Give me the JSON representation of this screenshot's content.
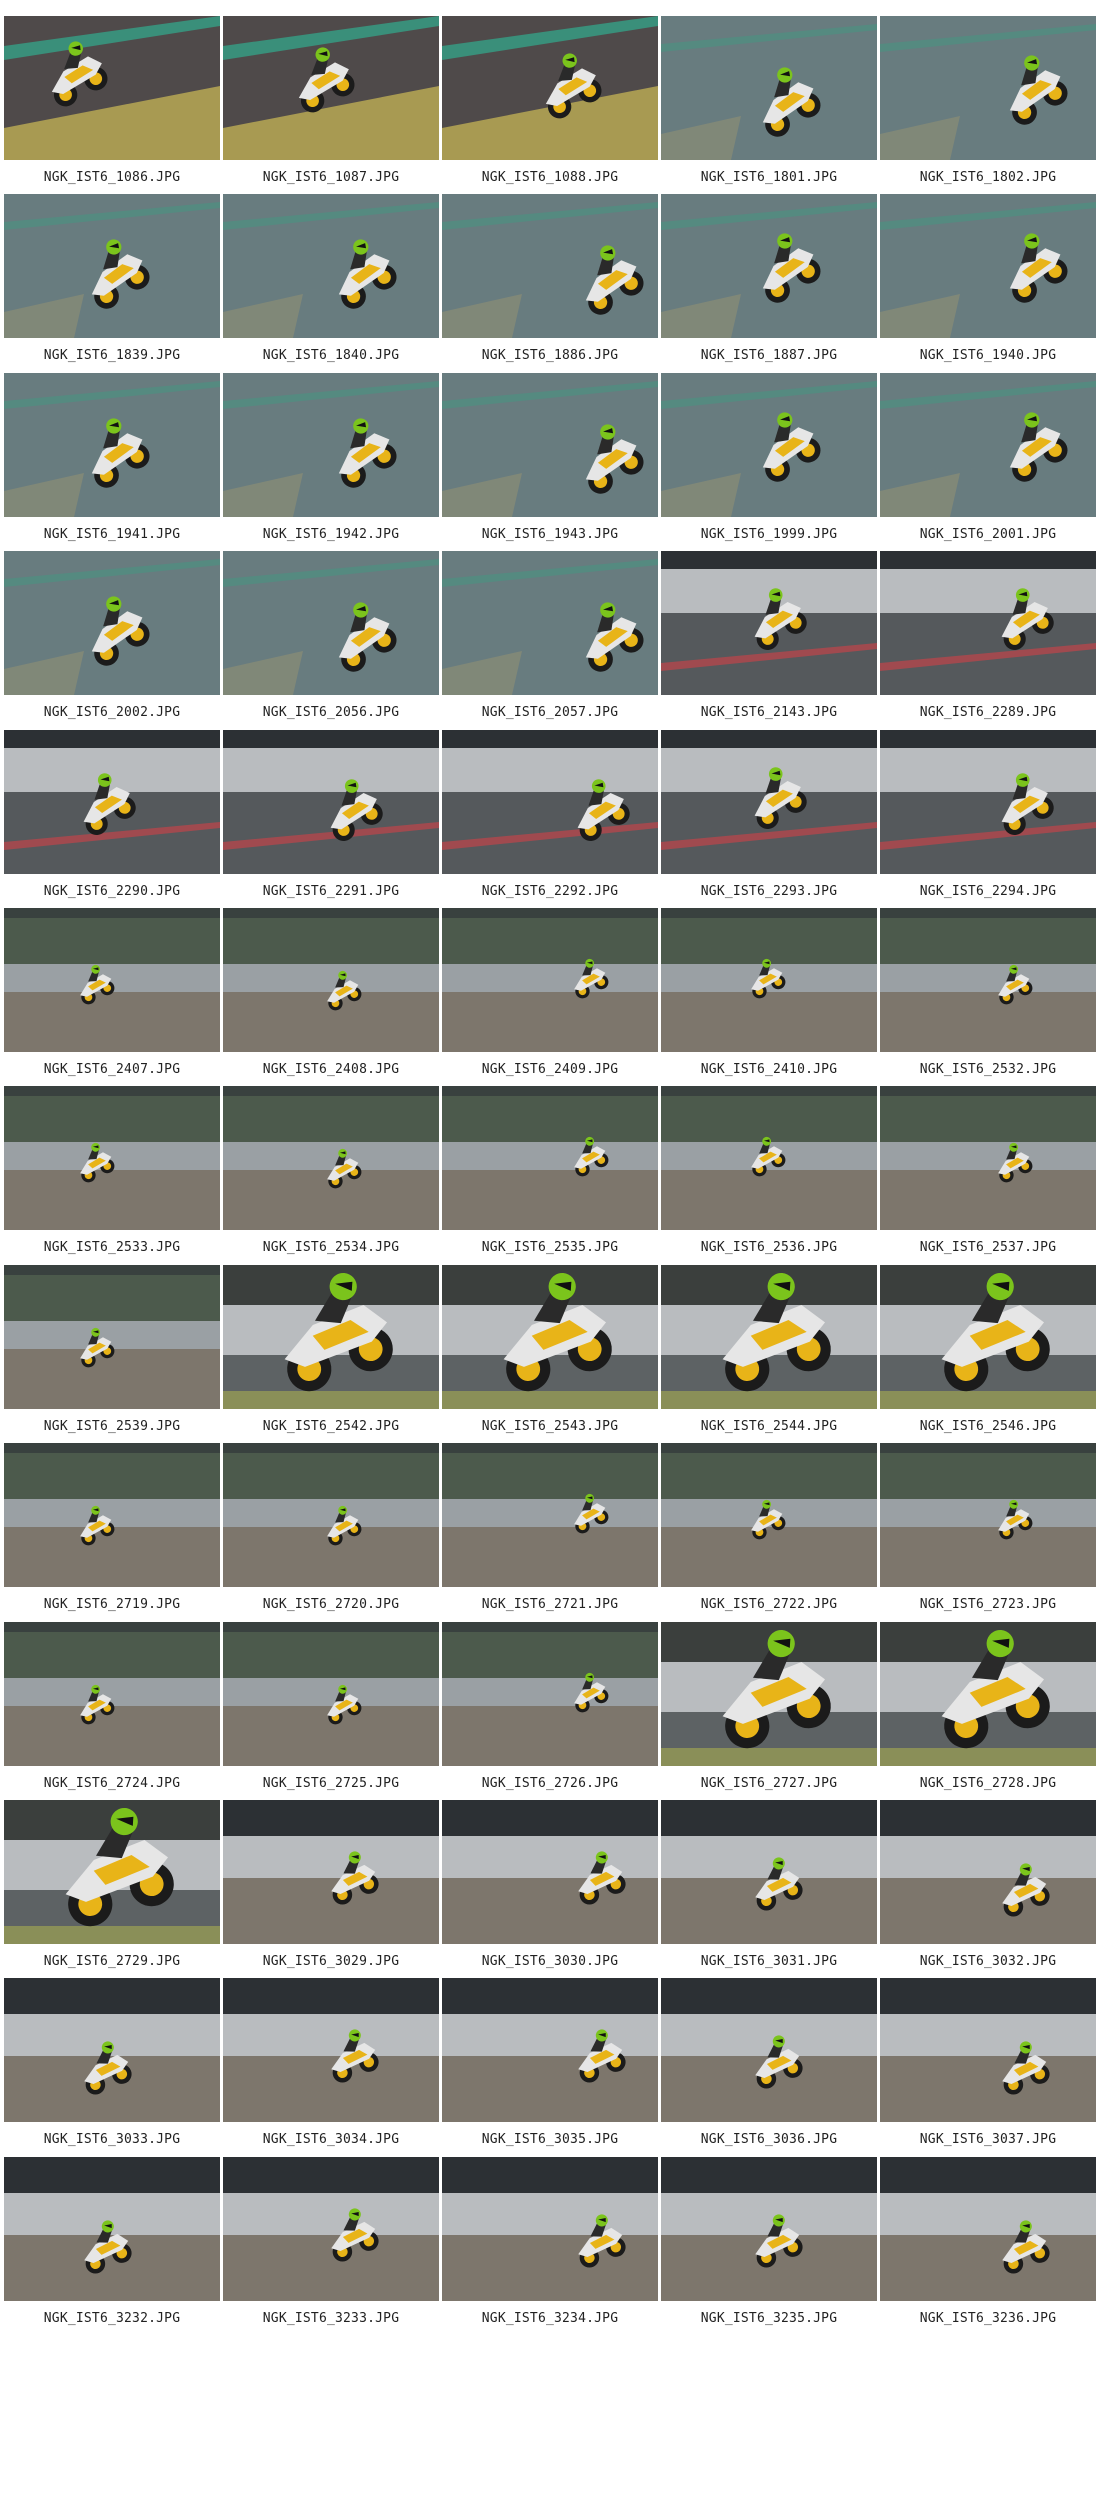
{
  "contact_sheet": {
    "items": [
      {
        "filename": "NGK_IST6_1086.JPG",
        "scene": "dry-grass"
      },
      {
        "filename": "NGK_IST6_1087.JPG",
        "scene": "dry-grass"
      },
      {
        "filename": "NGK_IST6_1088.JPG",
        "scene": "dry-grass"
      },
      {
        "filename": "NGK_IST6_1801.JPG",
        "scene": "wet-track"
      },
      {
        "filename": "NGK_IST6_1802.JPG",
        "scene": "wet-track"
      },
      {
        "filename": "NGK_IST6_1839.JPG",
        "scene": "wet-track"
      },
      {
        "filename": "NGK_IST6_1840.JPG",
        "scene": "wet-track"
      },
      {
        "filename": "NGK_IST6_1886.JPG",
        "scene": "wet-track"
      },
      {
        "filename": "NGK_IST6_1887.JPG",
        "scene": "wet-track"
      },
      {
        "filename": "NGK_IST6_1940.JPG",
        "scene": "wet-track"
      },
      {
        "filename": "NGK_IST6_1941.JPG",
        "scene": "wet-track"
      },
      {
        "filename": "NGK_IST6_1942.JPG",
        "scene": "wet-track"
      },
      {
        "filename": "NGK_IST6_1943.JPG",
        "scene": "wet-track"
      },
      {
        "filename": "NGK_IST6_1999.JPG",
        "scene": "wet-track"
      },
      {
        "filename": "NGK_IST6_2001.JPG",
        "scene": "wet-track"
      },
      {
        "filename": "NGK_IST6_2002.JPG",
        "scene": "wet-track"
      },
      {
        "filename": "NGK_IST6_2056.JPG",
        "scene": "wet-track"
      },
      {
        "filename": "NGK_IST6_2057.JPG",
        "scene": "wet-track"
      },
      {
        "filename": "NGK_IST6_2143.JPG",
        "scene": "barrier"
      },
      {
        "filename": "NGK_IST6_2289.JPG",
        "scene": "barrier"
      },
      {
        "filename": "NGK_IST6_2290.JPG",
        "scene": "barrier"
      },
      {
        "filename": "NGK_IST6_2291.JPG",
        "scene": "barrier"
      },
      {
        "filename": "NGK_IST6_2292.JPG",
        "scene": "barrier"
      },
      {
        "filename": "NGK_IST6_2293.JPG",
        "scene": "barrier"
      },
      {
        "filename": "NGK_IST6_2294.JPG",
        "scene": "barrier"
      },
      {
        "filename": "NGK_IST6_2407.JPG",
        "scene": "gravel"
      },
      {
        "filename": "NGK_IST6_2408.JPG",
        "scene": "gravel"
      },
      {
        "filename": "NGK_IST6_2409.JPG",
        "scene": "gravel"
      },
      {
        "filename": "NGK_IST6_2410.JPG",
        "scene": "gravel"
      },
      {
        "filename": "NGK_IST6_2532.JPG",
        "scene": "gravel"
      },
      {
        "filename": "NGK_IST6_2533.JPG",
        "scene": "gravel"
      },
      {
        "filename": "NGK_IST6_2534.JPG",
        "scene": "gravel"
      },
      {
        "filename": "NGK_IST6_2535.JPG",
        "scene": "gravel"
      },
      {
        "filename": "NGK_IST6_2536.JPG",
        "scene": "gravel"
      },
      {
        "filename": "NGK_IST6_2537.JPG",
        "scene": "gravel"
      },
      {
        "filename": "NGK_IST6_2539.JPG",
        "scene": "gravel"
      },
      {
        "filename": "NGK_IST6_2542.JPG",
        "scene": "closeup"
      },
      {
        "filename": "NGK_IST6_2543.JPG",
        "scene": "closeup"
      },
      {
        "filename": "NGK_IST6_2544.JPG",
        "scene": "closeup"
      },
      {
        "filename": "NGK_IST6_2546.JPG",
        "scene": "closeup"
      },
      {
        "filename": "NGK_IST6_2719.JPG",
        "scene": "gravel"
      },
      {
        "filename": "NGK_IST6_2720.JPG",
        "scene": "gravel"
      },
      {
        "filename": "NGK_IST6_2721.JPG",
        "scene": "gravel"
      },
      {
        "filename": "NGK_IST6_2722.JPG",
        "scene": "gravel"
      },
      {
        "filename": "NGK_IST6_2723.JPG",
        "scene": "gravel"
      },
      {
        "filename": "NGK_IST6_2724.JPG",
        "scene": "gravel"
      },
      {
        "filename": "NGK_IST6_2725.JPG",
        "scene": "gravel"
      },
      {
        "filename": "NGK_IST6_2726.JPG",
        "scene": "gravel"
      },
      {
        "filename": "NGK_IST6_2727.JPG",
        "scene": "closeup"
      },
      {
        "filename": "NGK_IST6_2728.JPG",
        "scene": "closeup"
      },
      {
        "filename": "NGK_IST6_2729.JPG",
        "scene": "closeup"
      },
      {
        "filename": "NGK_IST6_3029.JPG",
        "scene": "barrier-gravel"
      },
      {
        "filename": "NGK_IST6_3030.JPG",
        "scene": "barrier-gravel"
      },
      {
        "filename": "NGK_IST6_3031.JPG",
        "scene": "barrier-gravel"
      },
      {
        "filename": "NGK_IST6_3032.JPG",
        "scene": "barrier-gravel"
      },
      {
        "filename": "NGK_IST6_3033.JPG",
        "scene": "barrier-gravel"
      },
      {
        "filename": "NGK_IST6_3034.JPG",
        "scene": "barrier-gravel"
      },
      {
        "filename": "NGK_IST6_3035.JPG",
        "scene": "barrier-gravel"
      },
      {
        "filename": "NGK_IST6_3036.JPG",
        "scene": "barrier-gravel"
      },
      {
        "filename": "NGK_IST6_3037.JPG",
        "scene": "barrier-gravel"
      },
      {
        "filename": "NGK_IST6_3232.JPG",
        "scene": "barrier-gravel"
      },
      {
        "filename": "NGK_IST6_3233.JPG",
        "scene": "barrier-gravel"
      },
      {
        "filename": "NGK_IST6_3234.JPG",
        "scene": "barrier-gravel"
      },
      {
        "filename": "NGK_IST6_3235.JPG",
        "scene": "barrier-gravel"
      },
      {
        "filename": "NGK_IST6_3236.JPG",
        "scene": "barrier-gravel"
      }
    ]
  },
  "colors": {
    "background": "#ffffff",
    "label_text": "#222222",
    "bike_yellow": "#e8b418",
    "bike_white": "#e6e6e6",
    "helmet_green": "#7bc41c",
    "track_wet": "#5f7478",
    "track_dry": "#4f4a4a",
    "curb_teal": "#3a8f7a",
    "grass": "#a89a52",
    "barrier": "#b9bcbf",
    "gravel": "#7d766c",
    "dark_bg": "#2c3034"
  }
}
